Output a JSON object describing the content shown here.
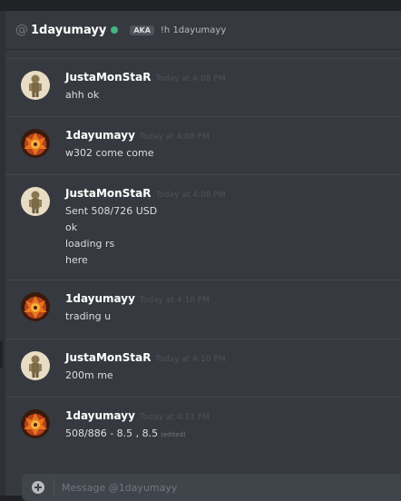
{
  "header": {
    "at_symbol": "@",
    "username": "1dayumayy",
    "aka_badge": "AKA",
    "nickname": "!h 1dayumayy"
  },
  "messages": [
    {
      "author": "JustaMonStaR",
      "timestamp": "Today at 4:08 PM",
      "lines": [
        "ahh ok"
      ]
    },
    {
      "author": "1dayumayy",
      "timestamp": "Today at 4:08 PM",
      "lines": [
        "w302 come come"
      ]
    },
    {
      "author": "JustaMonStaR",
      "timestamp": "Today at 4:08 PM",
      "lines": [
        "Sent 508/726 USD",
        "ok",
        "loading rs",
        "here"
      ]
    },
    {
      "author": "1dayumayy",
      "timestamp": "Today at 4:10 PM",
      "lines": [
        "trading u"
      ]
    },
    {
      "author": "JustaMonStaR",
      "timestamp": "Today at 4:10 PM",
      "lines": [
        "200m me"
      ]
    },
    {
      "author": "1dayumayy",
      "timestamp": "Today at 4:11 PM",
      "lines": [
        "508/886 - 8.5 , 8.5"
      ],
      "edited_label": "(edited)"
    }
  ],
  "composer": {
    "placeholder": "Message @1dayumayy"
  },
  "colors": {
    "online_status": "#43b581",
    "background": "#36393f"
  }
}
